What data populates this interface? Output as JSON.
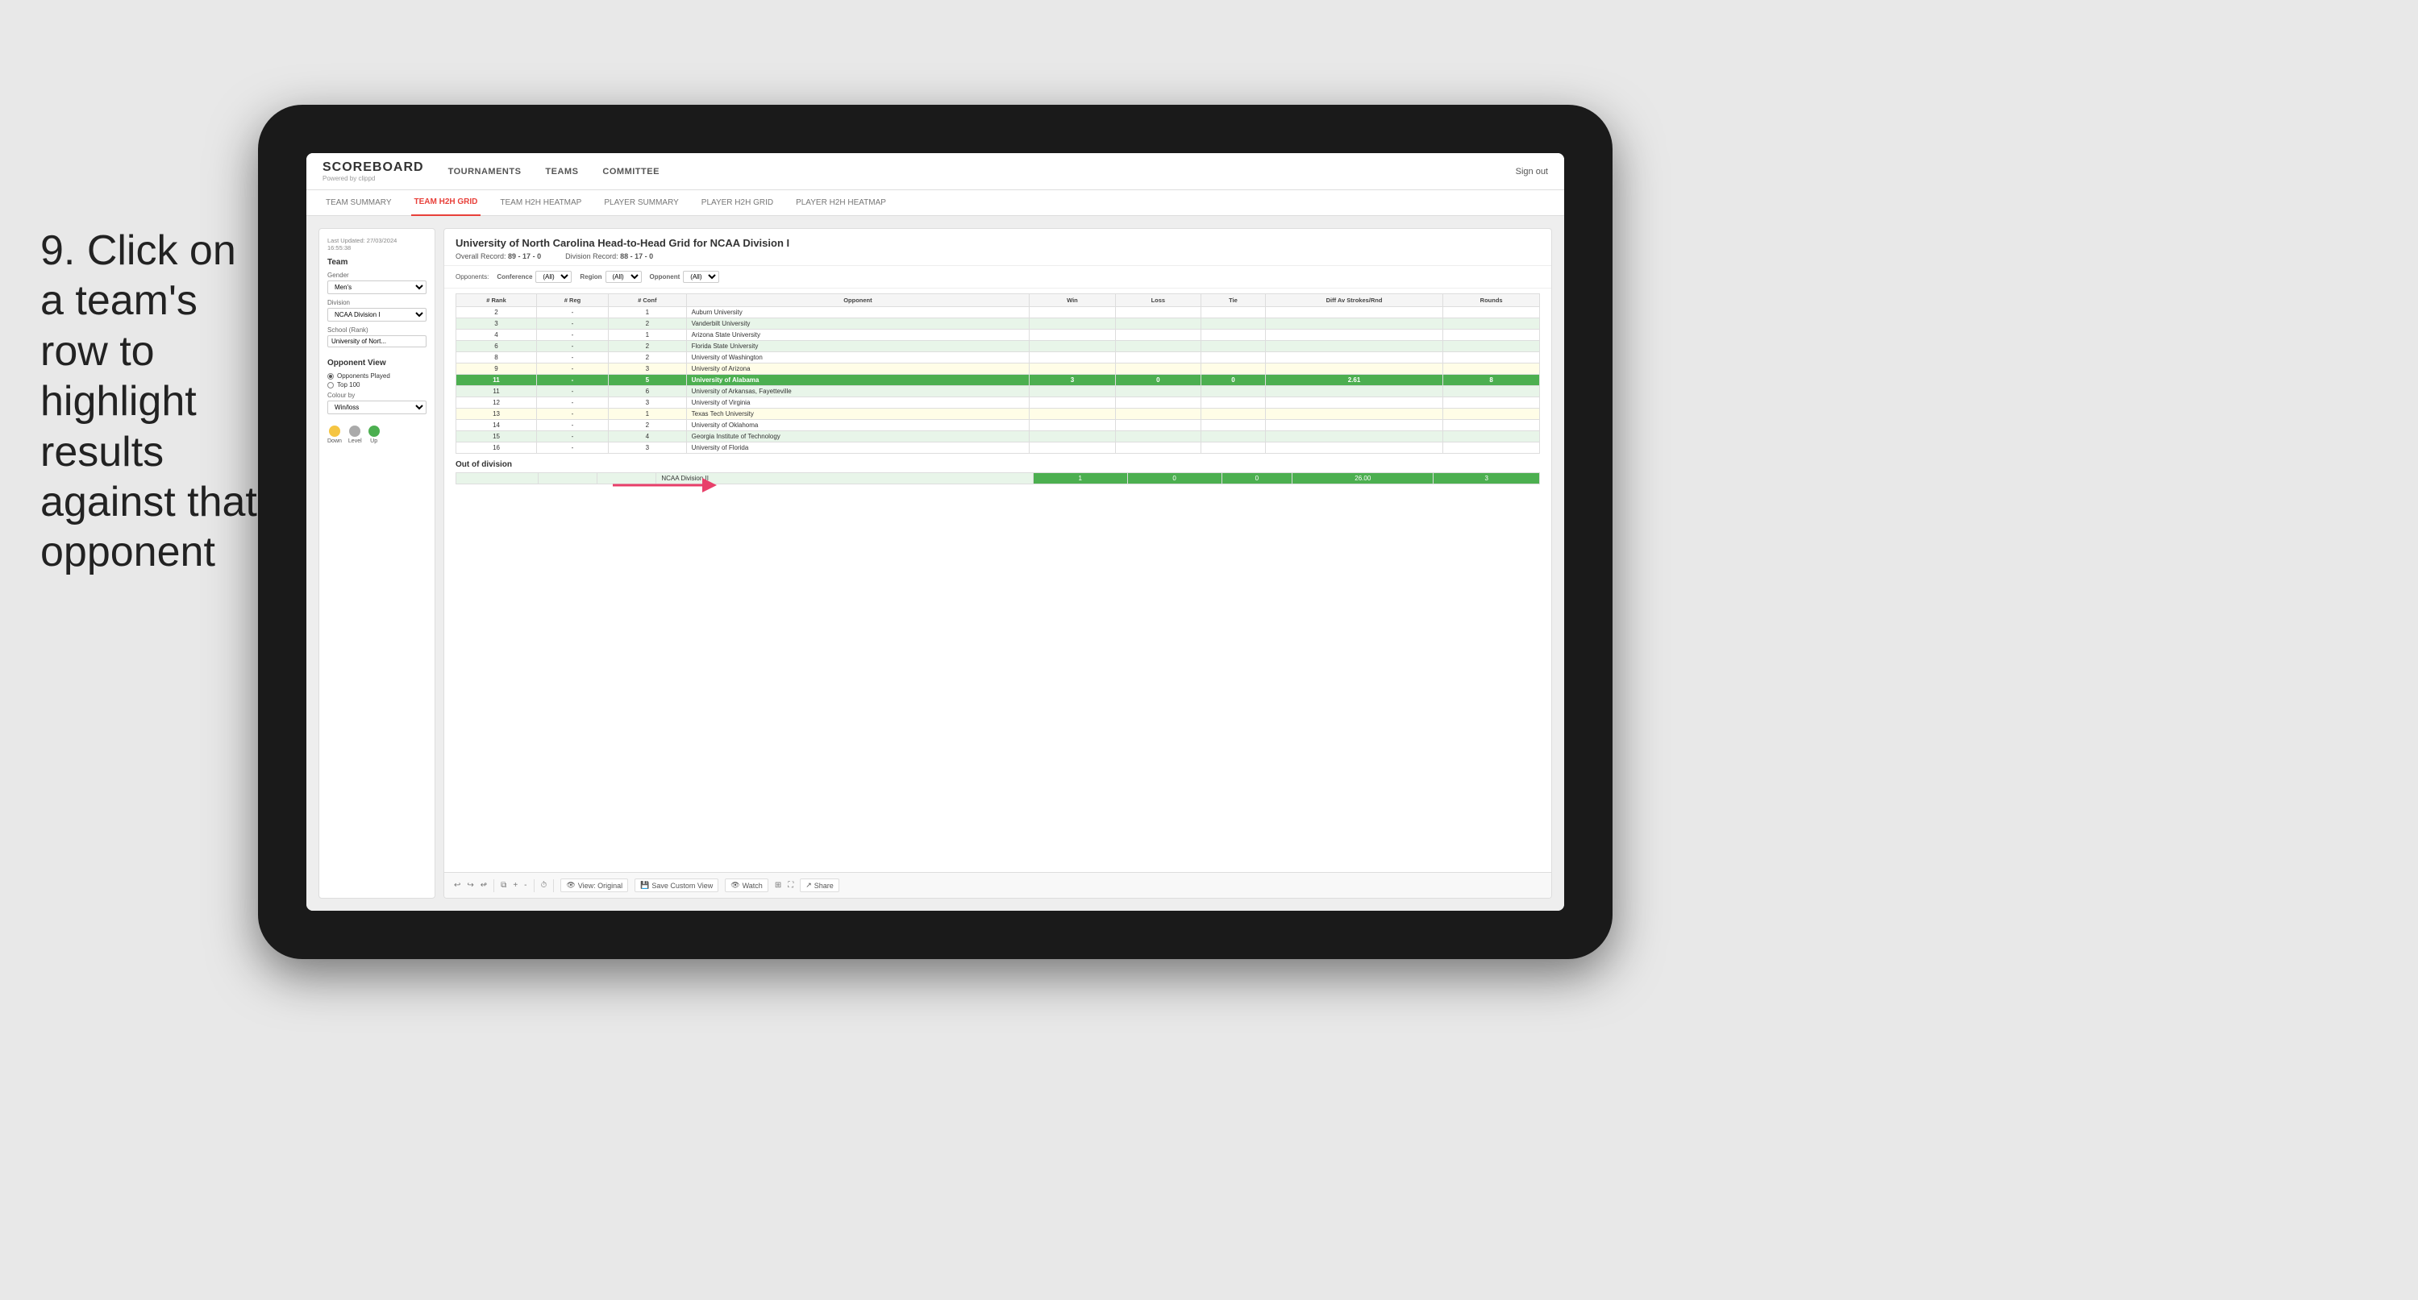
{
  "instruction": {
    "step": "9.",
    "text": "Click on a team's row to highlight results against that opponent"
  },
  "nav": {
    "logo": "SCOREBOARD",
    "logo_sub": "Powered by clippd",
    "items": [
      "TOURNAMENTS",
      "TEAMS",
      "COMMITTEE"
    ],
    "sign_out": "Sign out"
  },
  "sub_nav": {
    "items": [
      "TEAM SUMMARY",
      "TEAM H2H GRID",
      "TEAM H2H HEATMAP",
      "PLAYER SUMMARY",
      "PLAYER H2H GRID",
      "PLAYER H2H HEATMAP"
    ],
    "active": "TEAM H2H GRID"
  },
  "sidebar": {
    "last_updated_label": "Last Updated: 27/03/2024",
    "last_updated_time": "16:55:38",
    "team_label": "Team",
    "gender_label": "Gender",
    "gender_value": "Men's",
    "division_label": "Division",
    "division_value": "NCAA Division I",
    "school_label": "School (Rank)",
    "school_value": "University of Nort...",
    "opponent_view_label": "Opponent View",
    "opponents_played": "Opponents Played",
    "top_100": "Top 100",
    "colour_by_label": "Colour by",
    "colour_by_value": "Win/loss",
    "legend": {
      "down_label": "Down",
      "down_color": "#f5c542",
      "level_label": "Level",
      "level_color": "#aaa",
      "up_label": "Up",
      "up_color": "#4caf50"
    }
  },
  "grid": {
    "title": "University of North Carolina Head-to-Head Grid for NCAA Division I",
    "overall_record_label": "Overall Record:",
    "overall_record": "89 - 17 - 0",
    "division_record_label": "Division Record:",
    "division_record": "88 - 17 - 0",
    "filters": {
      "conference_label": "Conference",
      "conference_value": "(All)",
      "region_label": "Region",
      "region_value": "(All)",
      "opponent_label": "Opponent",
      "opponent_value": "(All)",
      "opponents_label": "Opponents:"
    },
    "table_headers": [
      "# Rank",
      "# Reg",
      "# Conf",
      "Opponent",
      "Win",
      "Loss",
      "Tie",
      "Diff Av Strokes/Rnd",
      "Rounds"
    ],
    "rows": [
      {
        "rank": "2",
        "reg": "-",
        "conf": "1",
        "opponent": "Auburn University",
        "win": "",
        "loss": "",
        "tie": "",
        "diff": "",
        "rounds": "",
        "style": "normal"
      },
      {
        "rank": "3",
        "reg": "-",
        "conf": "2",
        "opponent": "Vanderbilt University",
        "win": "",
        "loss": "",
        "tie": "",
        "diff": "",
        "rounds": "",
        "style": "light-green"
      },
      {
        "rank": "4",
        "reg": "-",
        "conf": "1",
        "opponent": "Arizona State University",
        "win": "",
        "loss": "",
        "tie": "",
        "diff": "",
        "rounds": "",
        "style": "normal"
      },
      {
        "rank": "6",
        "reg": "-",
        "conf": "2",
        "opponent": "Florida State University",
        "win": "",
        "loss": "",
        "tie": "",
        "diff": "",
        "rounds": "",
        "style": "light-green"
      },
      {
        "rank": "8",
        "reg": "-",
        "conf": "2",
        "opponent": "University of Washington",
        "win": "",
        "loss": "",
        "tie": "",
        "diff": "",
        "rounds": "",
        "style": "normal"
      },
      {
        "rank": "9",
        "reg": "-",
        "conf": "3",
        "opponent": "University of Arizona",
        "win": "",
        "loss": "",
        "tie": "",
        "diff": "",
        "rounds": "",
        "style": "light-yellow"
      },
      {
        "rank": "11",
        "reg": "-",
        "conf": "5",
        "opponent": "University of Alabama",
        "win": "3",
        "loss": "0",
        "tie": "0",
        "diff": "2.61",
        "rounds": "8",
        "style": "highlighted"
      },
      {
        "rank": "11",
        "reg": "-",
        "conf": "6",
        "opponent": "University of Arkansas, Fayetteville",
        "win": "",
        "loss": "",
        "tie": "",
        "diff": "",
        "rounds": "",
        "style": "light-green"
      },
      {
        "rank": "12",
        "reg": "-",
        "conf": "3",
        "opponent": "University of Virginia",
        "win": "",
        "loss": "",
        "tie": "",
        "diff": "",
        "rounds": "",
        "style": "normal"
      },
      {
        "rank": "13",
        "reg": "-",
        "conf": "1",
        "opponent": "Texas Tech University",
        "win": "",
        "loss": "",
        "tie": "",
        "diff": "",
        "rounds": "",
        "style": "light-yellow"
      },
      {
        "rank": "14",
        "reg": "-",
        "conf": "2",
        "opponent": "University of Oklahoma",
        "win": "",
        "loss": "",
        "tie": "",
        "diff": "",
        "rounds": "",
        "style": "normal"
      },
      {
        "rank": "15",
        "reg": "-",
        "conf": "4",
        "opponent": "Georgia Institute of Technology",
        "win": "",
        "loss": "",
        "tie": "",
        "diff": "",
        "rounds": "",
        "style": "light-green"
      },
      {
        "rank": "16",
        "reg": "-",
        "conf": "3",
        "opponent": "University of Florida",
        "win": "",
        "loss": "",
        "tie": "",
        "diff": "",
        "rounds": "",
        "style": "normal"
      }
    ],
    "out_of_division": {
      "label": "Out of division",
      "row": {
        "division": "NCAA Division II",
        "win": "1",
        "loss": "0",
        "tie": "0",
        "diff": "26.00",
        "rounds": "3"
      }
    }
  },
  "toolbar": {
    "view_original": "View: Original",
    "save_custom": "Save Custom View",
    "watch": "Watch",
    "share": "Share"
  }
}
